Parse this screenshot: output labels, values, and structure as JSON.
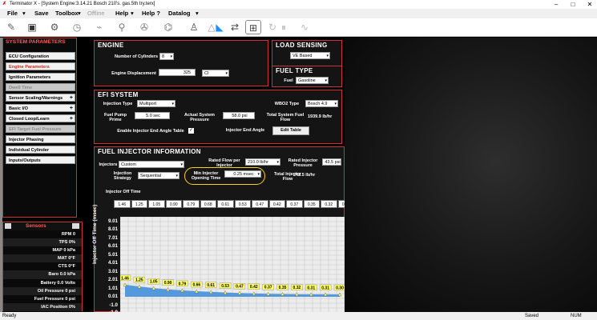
{
  "window": {
    "title": "Terminator X - [System Engine:3.14.21 Bosch 210's. gas.5th try.terx]"
  },
  "menu": {
    "file": "File",
    "save": "Save",
    "toolbox": "Toolbox",
    "offline": "Offline",
    "help": "Help",
    "help2": "Help ?",
    "datalog": "Datalog"
  },
  "toolbar_icons": [
    "wrench-icon",
    "ecu-icon",
    "engine-icon",
    "gauge-icon",
    "sensor-icon",
    "injector-icon",
    "fan-icon",
    "spark-icon",
    "person-icon",
    "triangle-icon",
    "funnel-icon",
    "file-transfer-icon",
    "connect-icon",
    "refresh-icon",
    "ecg-icon"
  ],
  "sidebar": {
    "title": "SYSTEM PARAMETERS",
    "items": [
      {
        "label": "ECU Configuration",
        "active": false,
        "dim": false,
        "plus": false
      },
      {
        "label": "Engine Parameters",
        "active": true,
        "dim": false,
        "plus": false
      },
      {
        "label": "Ignition Parameters",
        "active": false,
        "dim": false,
        "plus": false
      },
      {
        "label": "Dwell Time",
        "active": false,
        "dim": true,
        "plus": false
      },
      {
        "label": "Sensor Scaling/Warnings",
        "active": false,
        "dim": false,
        "plus": true
      },
      {
        "label": "Basic I/O",
        "active": false,
        "dim": false,
        "plus": true
      },
      {
        "label": "Closed Loop/Learn",
        "active": false,
        "dim": false,
        "plus": true
      },
      {
        "label": "EFI Target Fuel Pressure",
        "active": false,
        "dim": true,
        "plus": false
      },
      {
        "label": "Injector Phasing",
        "active": false,
        "dim": false,
        "plus": false
      },
      {
        "label": "Individual Cylinder",
        "active": false,
        "dim": false,
        "plus": false
      },
      {
        "label": "Inputs/Outputs",
        "active": false,
        "dim": false,
        "plus": false
      }
    ]
  },
  "sensors": {
    "title": "Sensors",
    "rows": [
      "RPM 0",
      "TPS 0%",
      "MAP 0 kPa",
      "MAT 0°F",
      "CTS 0°F",
      "Baro 0.0 kPa",
      "Battery 0.0 Volts",
      "Oil Pressure 0 psi",
      "Fuel Pressure 0 psi",
      "IAC Position 0%"
    ]
  },
  "engine": {
    "title": "ENGINE",
    "cylinders_label": "Number of Cylinders",
    "cylinders_value": "8",
    "displacement_label": "Engine Displacement",
    "displacement_value": "325",
    "displacement_unit": "CI"
  },
  "load_sensing": {
    "title": "LOAD SENSING",
    "value": "VE Based"
  },
  "fuel_type": {
    "title": "FUEL TYPE",
    "label": "Fuel",
    "value": "Gasoline"
  },
  "efi": {
    "title": "EFI SYSTEM",
    "injection_type_label": "Injection Type",
    "injection_type_value": "Multiport",
    "pump_label": "Fuel Pump Prime",
    "pump_value": "5.0 sec",
    "pressure_label": "Actual System Pressure",
    "pressure_value": "58.0 psi",
    "wbo2_label": "WBO2 Type",
    "wbo2_value": "Bosch 4.9",
    "total_flow_label": "Total System Fuel Flow",
    "total_flow_value": "1939.9 lb/hr",
    "end_angle_table_label": "Enable Injector End Angle Table",
    "end_angle_label": "Injector End Angle",
    "edit_table": "Edit Table"
  },
  "fuel_injector": {
    "title": "FUEL INJECTOR INFORMATION",
    "injectors_label": "Injectors",
    "injectors_value": "Custom",
    "rated_flow_label": "Rated Flow per Injector",
    "rated_flow_value": "210.0 lb/hr",
    "rated_pressure_label": "Rated Injector Pressure",
    "rated_pressure_value": "43.5 psi",
    "strategy_label": "Injection Strategy",
    "strategy_value": "Sequential",
    "min_open_label": "Min Injector Opening Time",
    "min_open_value": "0.25 msec",
    "total_flow_label": "Total Injector Flow",
    "total_flow_value": "242.5 lb/hr",
    "off_time_label": "Injector Off Time",
    "off_time_values": [
      "1.46",
      "1.25",
      "1.05",
      "0.90",
      "0.79",
      "0.68",
      "0.61",
      "0.53",
      "0.47",
      "0.42",
      "0.37",
      "0.35",
      "0.32",
      "0.31",
      "0.31",
      "0.30"
    ]
  },
  "chart_data": {
    "type": "area",
    "x": [
      1,
      2,
      3,
      4,
      5,
      6,
      7,
      8,
      9,
      10,
      11,
      12,
      13,
      14,
      15,
      16
    ],
    "values": [
      1.46,
      1.25,
      1.05,
      0.9,
      0.79,
      0.68,
      0.61,
      0.53,
      0.47,
      0.42,
      0.37,
      0.35,
      0.32,
      0.31,
      0.31,
      0.3
    ],
    "labels": [
      "1.46",
      "1.25",
      "1.05",
      "0.90",
      "0.79",
      "0.66",
      "0.61",
      "0.53",
      "0.47",
      "0.42",
      "0.37",
      "0.35",
      "0.32",
      "0.31",
      "0.31",
      "0.30"
    ],
    "ylabel": "Injector Off Time (msec)",
    "yticks": [
      "9.01",
      "8.01",
      "7.01",
      "6.01",
      "5.01",
      "4.01",
      "3.01",
      "2.01",
      "1.01",
      "0.01",
      "-1.0",
      "-1.9"
    ],
    "ylim": [
      -1.9,
      9.01
    ],
    "grid": true,
    "fill_color": "#5599dd"
  },
  "status": {
    "left": "Ready",
    "mid": "Saved",
    "right": "NUM"
  }
}
